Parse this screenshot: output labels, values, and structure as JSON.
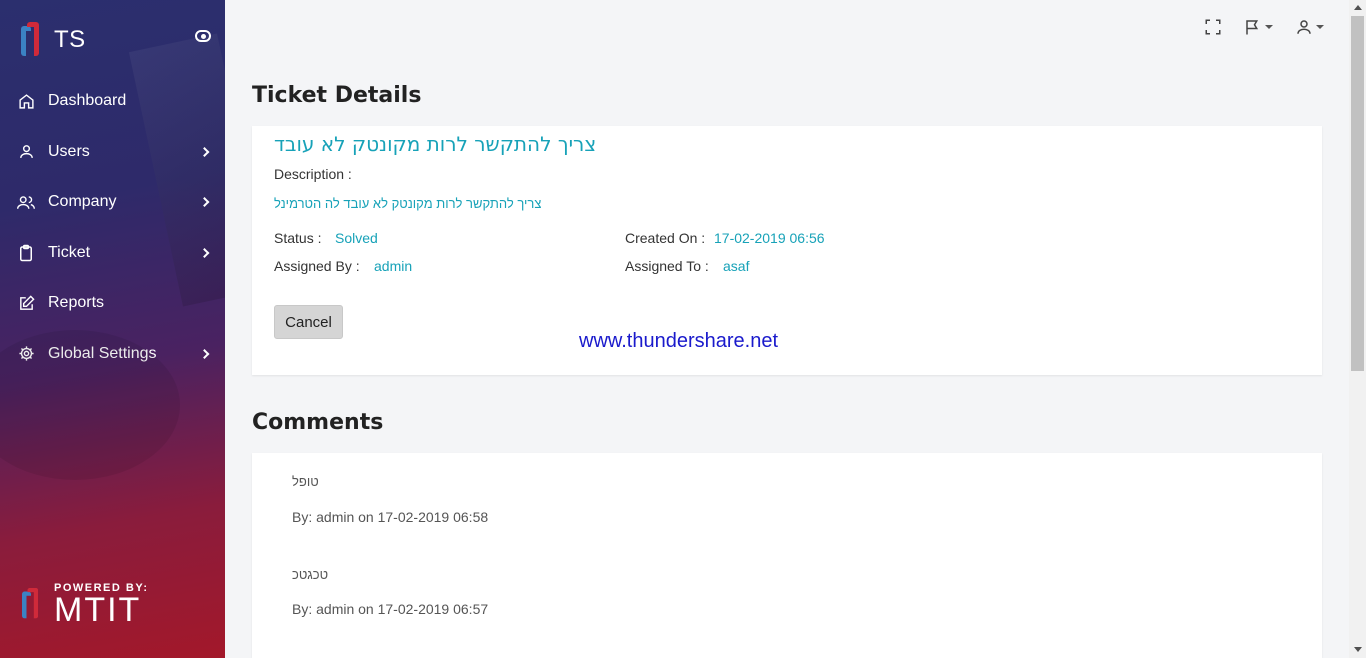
{
  "brand": {
    "name": "TS",
    "toggle_icon": "eye-toggle-icon"
  },
  "sidebar": {
    "items": [
      {
        "label": "Dashboard",
        "icon": "home-icon",
        "has_submenu": false
      },
      {
        "label": "Users",
        "icon": "user-icon",
        "has_submenu": true
      },
      {
        "label": "Company",
        "icon": "users-icon",
        "has_submenu": true
      },
      {
        "label": "Ticket",
        "icon": "clipboard-icon",
        "has_submenu": true
      },
      {
        "label": "Reports",
        "icon": "edit-icon",
        "has_submenu": false
      },
      {
        "label": "Global Settings",
        "icon": "gear-icon",
        "has_submenu": true
      }
    ],
    "powered_label": "POWERED BY:",
    "powered_name": "MTIT"
  },
  "topbar": {
    "icons": [
      "fullscreen-icon",
      "flag-icon",
      "user-icon"
    ]
  },
  "ticket": {
    "heading": "Ticket Details",
    "title": "צריך להתקשר לרות מקונטק לא עובד",
    "description_label": "Description :",
    "description": "צריך להתקשר לרות מקונטק לא עובד לה הטרמינל",
    "status_label": "Status :",
    "status": "Solved",
    "created_label": "Created On :",
    "created": "17-02-2019 06:56",
    "assigned_by_label": "Assigned By :",
    "assigned_by": "admin",
    "assigned_to_label": "Assigned To :",
    "assigned_to": "asaf",
    "cancel_label": "Cancel",
    "watermark": "www.thundershare.net"
  },
  "comments": {
    "heading": "Comments",
    "items": [
      {
        "text": "טופל",
        "meta": "By: admin on 17-02-2019 06:58"
      },
      {
        "text": "טכגטכ",
        "meta": "By: admin on 17-02-2019 06:57"
      }
    ]
  },
  "colors": {
    "accent": "#17a2b8",
    "watermark": "#1a1acc",
    "sidebar_top": "#2b2f6e",
    "sidebar_bottom": "#a3182a"
  }
}
